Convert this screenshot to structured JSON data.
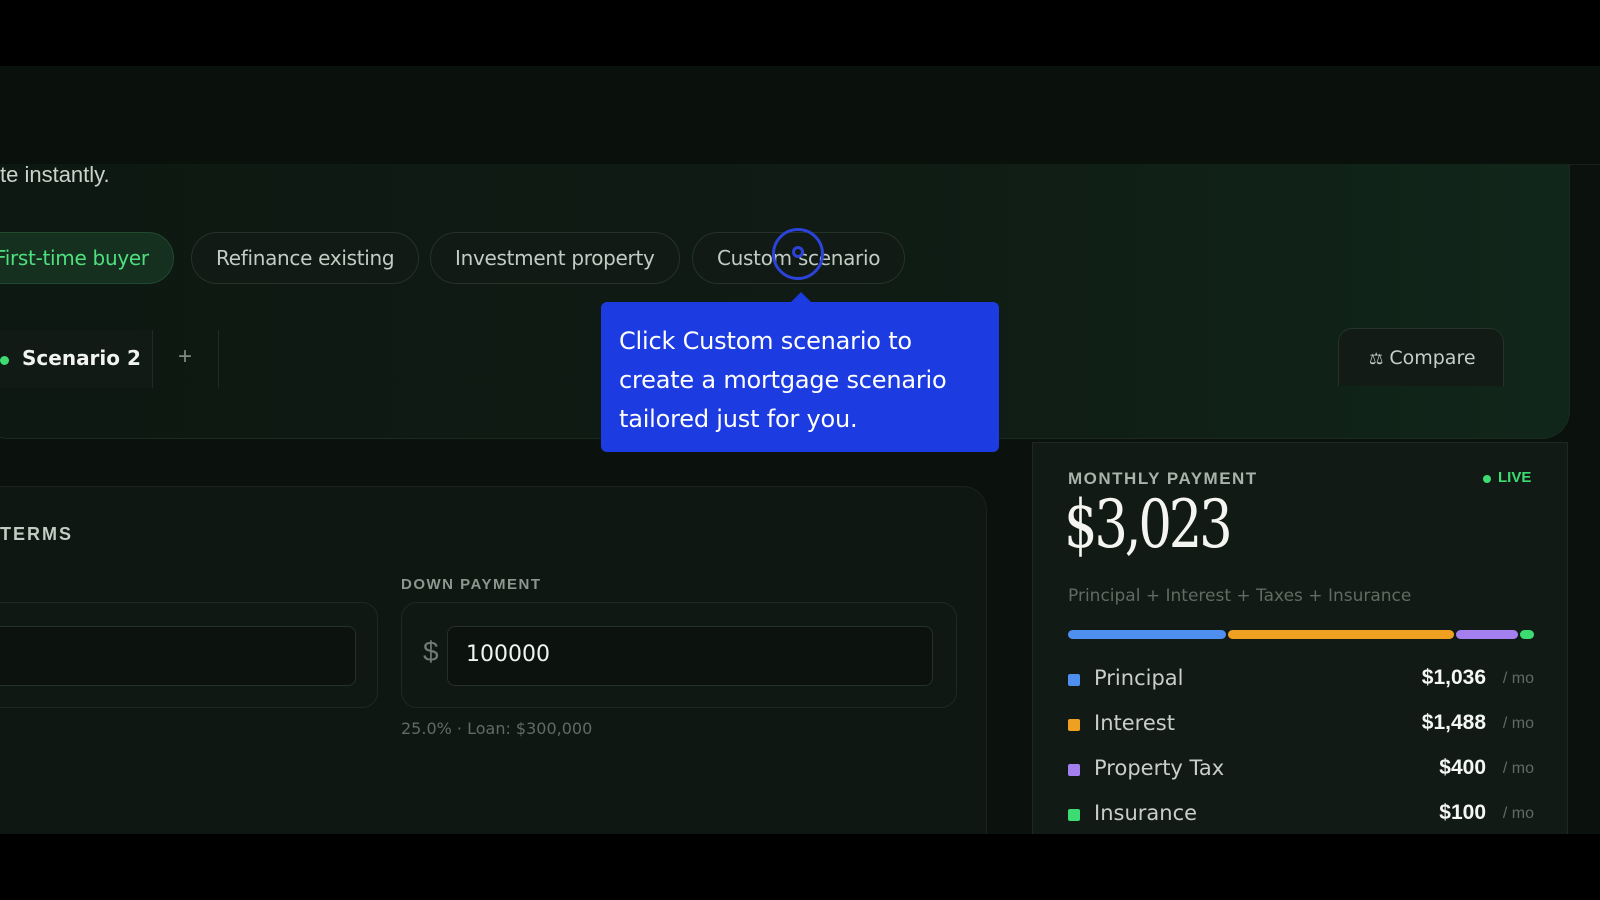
{
  "hero": {
    "subtitle": "te instantly.",
    "presets": [
      "First-time buyer",
      "Refinance existing",
      "Investment property",
      "Custom scenario"
    ],
    "active_preset": "First-time buyer",
    "scenario_tab": "Scenario 2",
    "add_tab": "+",
    "compare_label": "Compare"
  },
  "tooltip": {
    "lines": [
      "Click Custom scenario to",
      "create a mortgage scenario",
      "tailored just for you."
    ]
  },
  "terms": {
    "title": "TERMS",
    "down_payment": {
      "label": "DOWN PAYMENT",
      "currency": "$",
      "value": "100000",
      "hint": "25.0% · Loan: $300,000"
    }
  },
  "payment": {
    "title": "MONTHLY PAYMENT",
    "live": "LIVE",
    "amount": "$3,023",
    "subtitle": "Principal + Interest + Taxes + Insurance",
    "unit": "/ mo",
    "breakdown": [
      {
        "name": "Principal",
        "value": "$1,036",
        "amount": 1036,
        "color": "#4f8ff0"
      },
      {
        "name": "Interest",
        "value": "$1,488",
        "amount": 1488,
        "color": "#f0a020"
      },
      {
        "name": "Property Tax",
        "value": "$400",
        "amount": 400,
        "color": "#a47ff0"
      },
      {
        "name": "Insurance",
        "value": "$100",
        "amount": 100,
        "color": "#3ddc73"
      }
    ]
  }
}
